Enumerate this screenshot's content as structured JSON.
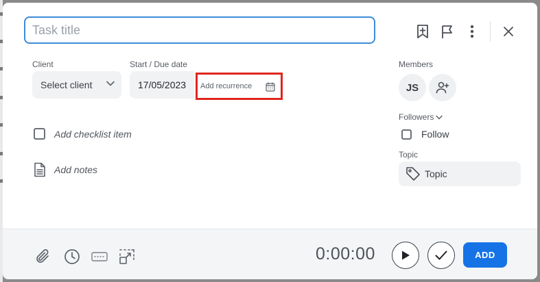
{
  "task": {
    "title_value": "",
    "title_placeholder": "Task title"
  },
  "header_icons": [
    "bookmark-add-icon",
    "flag-icon",
    "more-vertical-icon",
    "close-icon"
  ],
  "client": {
    "label": "Client",
    "value": "Select client"
  },
  "date": {
    "label": "Start / Due date",
    "value": "17/05/2023",
    "recurrence_label": "Add recurrence"
  },
  "checklist": {
    "placeholder": "Add checklist item"
  },
  "notes": {
    "placeholder": "Add notes"
  },
  "members": {
    "label": "Members",
    "avatars": [
      "JS"
    ]
  },
  "followers": {
    "label": "Followers",
    "follow_label": "Follow"
  },
  "topic": {
    "label": "Topic",
    "placeholder": "Topic"
  },
  "footer": {
    "icons": [
      "paperclip-icon",
      "clock-icon",
      "keyboard-icon",
      "focus-icon"
    ],
    "timer": "0:00:00",
    "add_label": "ADD"
  },
  "colors": {
    "accent": "#1673e6",
    "input_focus": "#3d8bd9",
    "highlight": "#e0261d"
  }
}
